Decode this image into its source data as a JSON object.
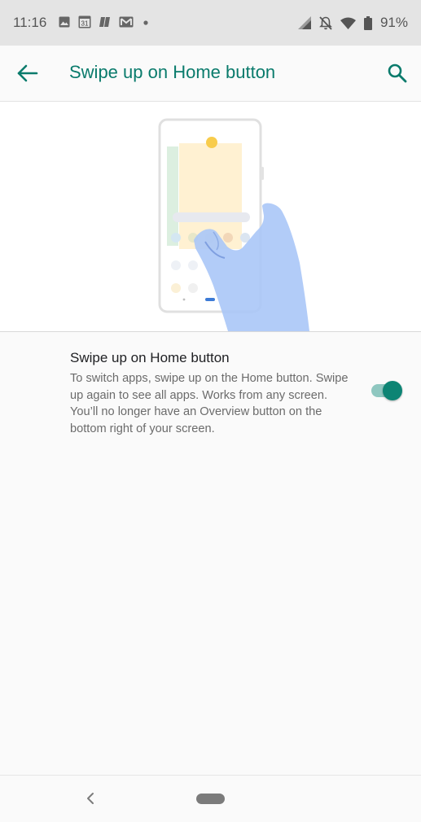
{
  "status_bar": {
    "time": "11:16",
    "battery": "91%",
    "icons": [
      "image-icon",
      "calendar-icon",
      "reading-icon",
      "gmail-icon",
      "dot-icon",
      "signal-icon",
      "notifications-off-icon",
      "wifi-icon",
      "battery-icon"
    ],
    "calendar_day": "31"
  },
  "app_bar": {
    "title": "Swipe up on Home button",
    "accent": "#0a7b6c"
  },
  "setting": {
    "title": "Swipe up on Home button",
    "summary": "To switch apps, swipe up on the Home button. Swipe up again to see all apps. Works from any screen. You’ll no longer have an Overview button on the bottom right of your screen.",
    "enabled": true
  },
  "nav_bar": {
    "icons": [
      "nav-back-icon",
      "home-pill"
    ]
  }
}
